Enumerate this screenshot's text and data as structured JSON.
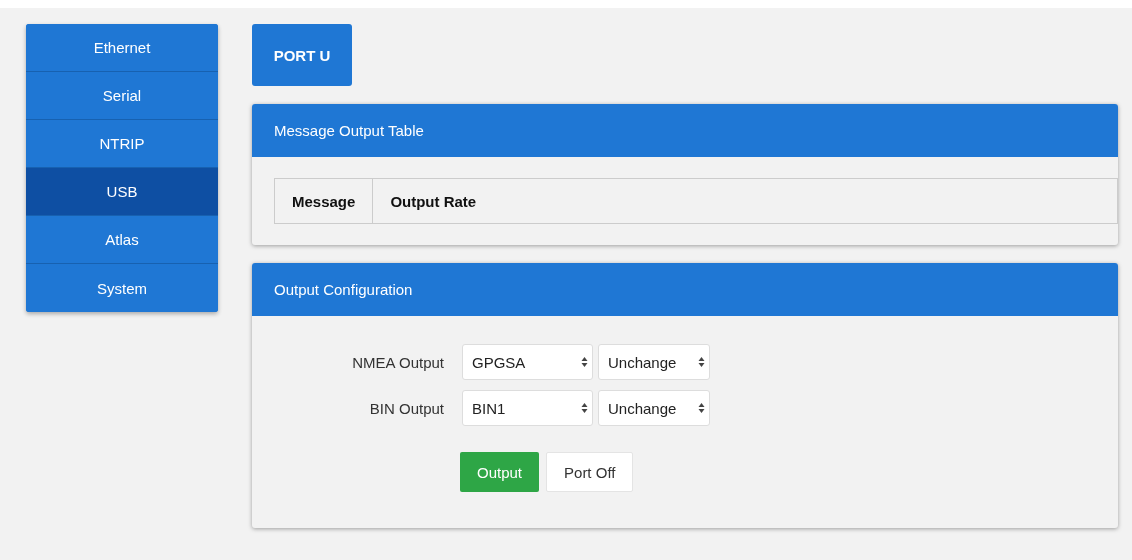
{
  "sidebar": {
    "items": [
      {
        "label": "Ethernet",
        "selected": false
      },
      {
        "label": "Serial",
        "selected": false
      },
      {
        "label": "NTRIP",
        "selected": false
      },
      {
        "label": "USB",
        "selected": true
      },
      {
        "label": "Atlas",
        "selected": false
      },
      {
        "label": "System",
        "selected": false
      }
    ]
  },
  "port_button": "PORT U",
  "message_table": {
    "title": "Message Output Table",
    "columns": [
      "Message",
      "Output Rate"
    ]
  },
  "output_configuration": {
    "title": "Output Configuration",
    "rows": [
      {
        "label": "NMEA Output",
        "message": "GPGSA",
        "rate": "Unchange"
      },
      {
        "label": "BIN Output",
        "message": "BIN1",
        "rate": "Unchange"
      }
    ],
    "buttons": [
      {
        "label": "Output",
        "kind": "primary"
      },
      {
        "label": "Port Off",
        "kind": "default"
      }
    ]
  }
}
